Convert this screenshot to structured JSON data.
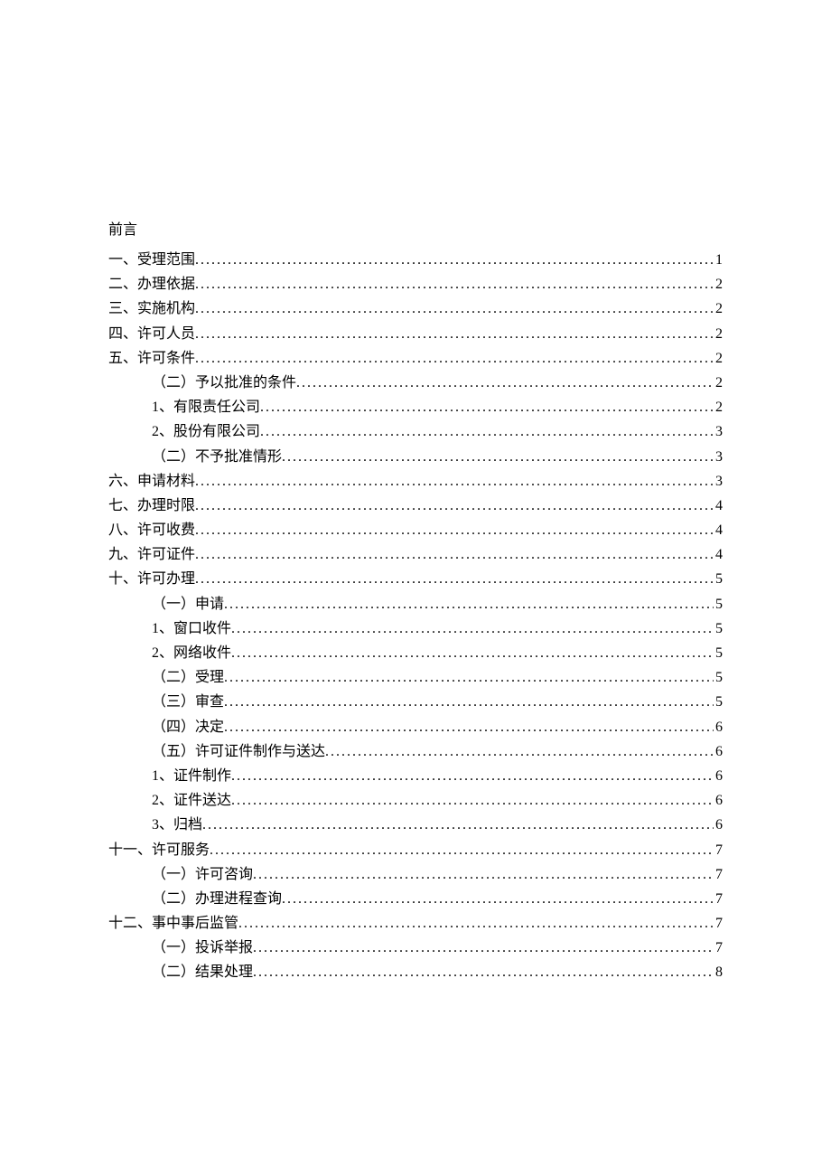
{
  "preface": "前言",
  "toc": [
    {
      "level": 1,
      "label": "一、受理范围",
      "page": "1"
    },
    {
      "level": 1,
      "label": "二、办理依据",
      "page": "2"
    },
    {
      "level": 1,
      "label": "三、实施机构",
      "page": "2"
    },
    {
      "level": 1,
      "label": "四、许可人员",
      "page": "2"
    },
    {
      "level": 1,
      "label": "五、许可条件",
      "page": "2"
    },
    {
      "level": 2,
      "label": "（二）予以批准的条件",
      "page": "2"
    },
    {
      "level": 2,
      "label": "1、有限责任公司",
      "page": "2"
    },
    {
      "level": 2,
      "label": "2、股份有限公司",
      "page": "3"
    },
    {
      "level": 2,
      "label": "（二）不予批准情形",
      "page": "3"
    },
    {
      "level": 1,
      "label": "六、申请材料",
      "page": "3"
    },
    {
      "level": 1,
      "label": "七、办理时限",
      "page": "4"
    },
    {
      "level": 1,
      "label": "八、许可收费",
      "page": "4"
    },
    {
      "level": 1,
      "label": "九、许可证件",
      "page": "4"
    },
    {
      "level": 1,
      "label": "十、许可办理",
      "page": "5"
    },
    {
      "level": 2,
      "label": "（一）申请",
      "page": "5"
    },
    {
      "level": 2,
      "label": "1、窗口收件",
      "page": "5"
    },
    {
      "level": 2,
      "label": "2、网络收件",
      "page": "5"
    },
    {
      "level": 2,
      "label": "（二）受理",
      "page": "5"
    },
    {
      "level": 2,
      "label": "（三）审查",
      "page": "5"
    },
    {
      "level": 2,
      "label": "（四）决定",
      "page": "6"
    },
    {
      "level": 2,
      "label": "（五）许可证件制作与送达",
      "page": "6"
    },
    {
      "level": 2,
      "label": "1、证件制作",
      "page": "6"
    },
    {
      "level": 2,
      "label": "2、证件送达",
      "page": "6"
    },
    {
      "level": 2,
      "label": "3、归档",
      "page": "6"
    },
    {
      "level": 1,
      "label": "十一、许可服务",
      "page": "7"
    },
    {
      "level": 2,
      "label": "（一）许可咨询",
      "page": "7"
    },
    {
      "level": 2,
      "label": "（二）办理进程查询",
      "page": "7"
    },
    {
      "level": 1,
      "label": "十二、事中事后监管",
      "page": "7"
    },
    {
      "level": 2,
      "label": "（一）投诉举报",
      "page": "7"
    },
    {
      "level": 2,
      "label": "（二）结果处理",
      "page": "8"
    }
  ]
}
